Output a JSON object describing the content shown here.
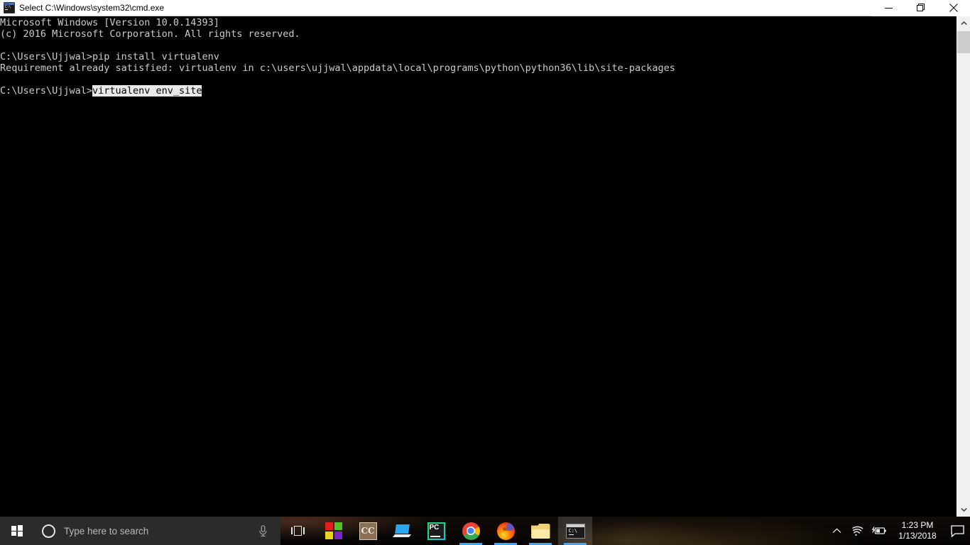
{
  "window": {
    "title": "Select C:\\Windows\\system32\\cmd.exe",
    "icon": "cmd-console-icon",
    "buttons": {
      "minimize": "minimize-button",
      "restore": "restore-button",
      "close": "close-button"
    }
  },
  "console": {
    "background_color": "#000000",
    "text_color": "#cccccc",
    "selection_background": "#e8e8e8",
    "selection_text_color": "#000000",
    "lines": [
      {
        "text": "Microsoft Windows [Version 10.0.14393]",
        "selected": ""
      },
      {
        "text": "(c) 2016 Microsoft Corporation. All rights reserved.",
        "selected": ""
      },
      {
        "text": "",
        "selected": ""
      },
      {
        "text": "C:\\Users\\Ujjwal>pip install virtualenv",
        "selected": ""
      },
      {
        "text": "Requirement already satisfied: virtualenv in c:\\users\\ujjwal\\appdata\\local\\programs\\python\\python36\\lib\\site-packages",
        "selected": ""
      },
      {
        "text": "",
        "selected": ""
      },
      {
        "text": "C:\\Users\\Ujjwal>",
        "selected": "virtualenv env_site"
      }
    ],
    "prompt": "C:\\Users\\Ujjwal>",
    "current_command": "virtualenv env_site"
  },
  "scrollbar": {
    "up_arrow": "scroll-up-arrow",
    "down_arrow": "scroll-down-arrow",
    "thumb": "scroll-thumb"
  },
  "taskbar": {
    "start": "start-button",
    "search": {
      "placeholder": "Type here to search",
      "cortana_icon": "cortana-circle-icon",
      "mic_icon": "microphone-icon"
    },
    "task_view": "task-view-button",
    "pinned": [
      {
        "name": "microsoft-store",
        "label": "Microsoft Store",
        "running": false
      },
      {
        "name": "cc-app",
        "label": "CC",
        "running": false
      },
      {
        "name": "remote-desktop",
        "label": "Remote Desktop",
        "running": false
      },
      {
        "name": "pycharm",
        "label": "PyCharm",
        "running": false
      },
      {
        "name": "google-chrome",
        "label": "Google Chrome",
        "running": true
      },
      {
        "name": "mozilla-firefox",
        "label": "Mozilla Firefox",
        "running": true
      },
      {
        "name": "file-explorer",
        "label": "File Explorer",
        "running": true
      },
      {
        "name": "command-prompt",
        "label": "Command Prompt",
        "running": true,
        "active": true
      }
    ],
    "tray": {
      "chevron": "show-hidden-icons",
      "wifi": "wifi-icon",
      "battery": "battery-charging-icon",
      "time": "1:23 PM",
      "date": "1/13/2018",
      "action_center": "action-center-icon"
    }
  },
  "colors": {
    "titlebar_bg": "#ffffff",
    "console_bg": "#000000",
    "taskbar_bg": "#0d0906",
    "search_bg": "#2b2b2b",
    "running_underline": "#4aa3e8"
  }
}
